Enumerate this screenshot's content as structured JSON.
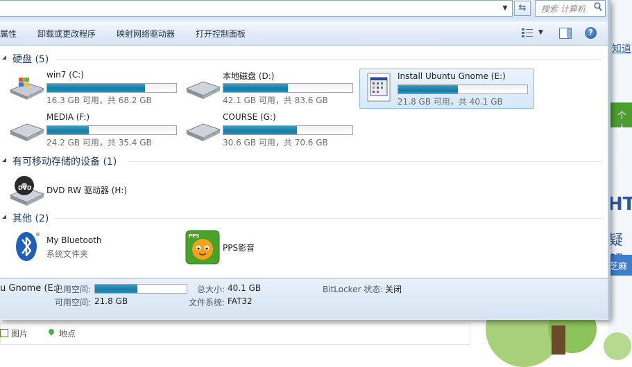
{
  "address": {
    "search_placeholder": "搜索 计算机"
  },
  "toolbar": {
    "items": [
      "属性",
      "卸载或更改程序",
      "映射网络驱动器",
      "打开控制面板"
    ]
  },
  "groups": {
    "hard_disks": {
      "title": "硬盘 (5)"
    },
    "removable": {
      "title": "有可移动存储的设备 (1)"
    },
    "other": {
      "title": "其他 (2)"
    }
  },
  "drives": [
    {
      "name": "win7 (C:)",
      "free": "16.3 GB 可用，共 68.2 GB",
      "used_fraction": 0.76,
      "icon": "windows-drive-icon"
    },
    {
      "name": "本地磁盘 (D:)",
      "free": "42.1 GB 可用，共 83.6 GB",
      "used_fraction": 0.5,
      "icon": "hard-drive-icon"
    },
    {
      "name": "Install Ubuntu Gnome (E:)",
      "free": "21.8 GB 可用，共 40.1 GB",
      "used_fraction": 0.46,
      "icon": "drive-app-icon",
      "selected": true
    },
    {
      "name": "MEDIA (F:)",
      "free": "24.2 GB 可用，共 35.4 GB",
      "used_fraction": 0.32,
      "icon": "hard-drive-icon"
    },
    {
      "name": "COURSE (G:)",
      "free": "30.6 GB 可用，共 70.6 GB",
      "used_fraction": 0.57,
      "icon": "hard-drive-icon"
    }
  ],
  "removable": [
    {
      "name": "DVD RW 驱动器 (H:)",
      "icon": "dvd-drive-icon"
    }
  ],
  "other": [
    {
      "name": "My Bluetooth",
      "sub": "系统文件夹",
      "icon": "bluetooth-icon"
    },
    {
      "name": "PPS影音",
      "icon": "pps-icon"
    }
  ],
  "details": {
    "title": "u Gnome (E:)",
    "used_label": "已用空间:",
    "used_fraction": 0.46,
    "free_label": "可用空间:",
    "free_value": "21.8 GB",
    "total_label": "总大小:",
    "total_value": "40.1 GB",
    "fs_label": "文件系统:",
    "fs_value": "FAT32",
    "bitlocker_label": "BitLocker 状态:",
    "bitlocker_value": "关闭"
  },
  "background": {
    "link": "知道",
    "green_btn": "个人",
    "big1": "HT",
    "big2": "疑解",
    "blue_btn": "芝麻",
    "pic_label": "图片",
    "place_label": "地点"
  }
}
